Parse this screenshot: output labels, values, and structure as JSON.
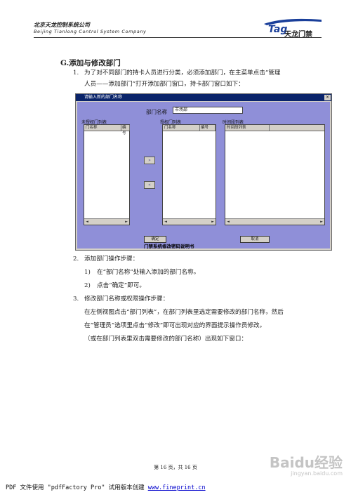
{
  "header": {
    "company_cn": "北京天龙控制系统公司",
    "company_en": "Beijing Tianlong Control System Company",
    "brand": "天龙门禁"
  },
  "section": {
    "title": "G.添加与修改部门",
    "items": [
      {
        "num": "1.",
        "line1": "为了对不同部门的持卡人员进行分类，必须添加部门，在主菜单点击“管理",
        "line2": "人员——添加部门”打开添加部门窗口，持卡部门窗口如下："
      },
      {
        "num": "2.",
        "text": "添加部门操作步骤："
      },
      {
        "num": "1)",
        "text": "在“部门名称”处输入添加的部门名称。"
      },
      {
        "num": "2)",
        "text": "点击“确定”即可。"
      },
      {
        "num": "3.",
        "text": "修改部门名称或权限操作步骤："
      },
      {
        "line": "在左侧视图点击“部门列表”，在部门列表里选定需要修改的部门名称，然后"
      },
      {
        "line": "在“管理员”选项里点击“修改”即可出现对应的界面提示操作员修改。"
      },
      {
        "line": "（或在部门列表里双击需要修改的部门名称）出现如下窗口："
      }
    ]
  },
  "dialog": {
    "title": "请输入新的部门名称",
    "close": "×",
    "dept_label": "部门名称",
    "dept_value": "市场部",
    "left_group": "未授权门列表",
    "mid_group": "授权门列表",
    "right_group": "时间段列表",
    "col_door": "门名称",
    "col_num": "编号",
    "col_time": "时间段列表",
    "move_right": "»",
    "move_left": "«",
    "ok": "确定",
    "cancel": "取消",
    "caption": "门禁系统修改密码说明书"
  },
  "footer": {
    "page": "第 16 页，共 16 页",
    "pdf_note": "PDF 文件使用 \"pdfFactory Pro\" 试用版本创建 ",
    "pdf_link": "www.fineprint.cn",
    "watermark_brand": "Baidu经验",
    "watermark_url": "jingyan.baidu.com"
  }
}
